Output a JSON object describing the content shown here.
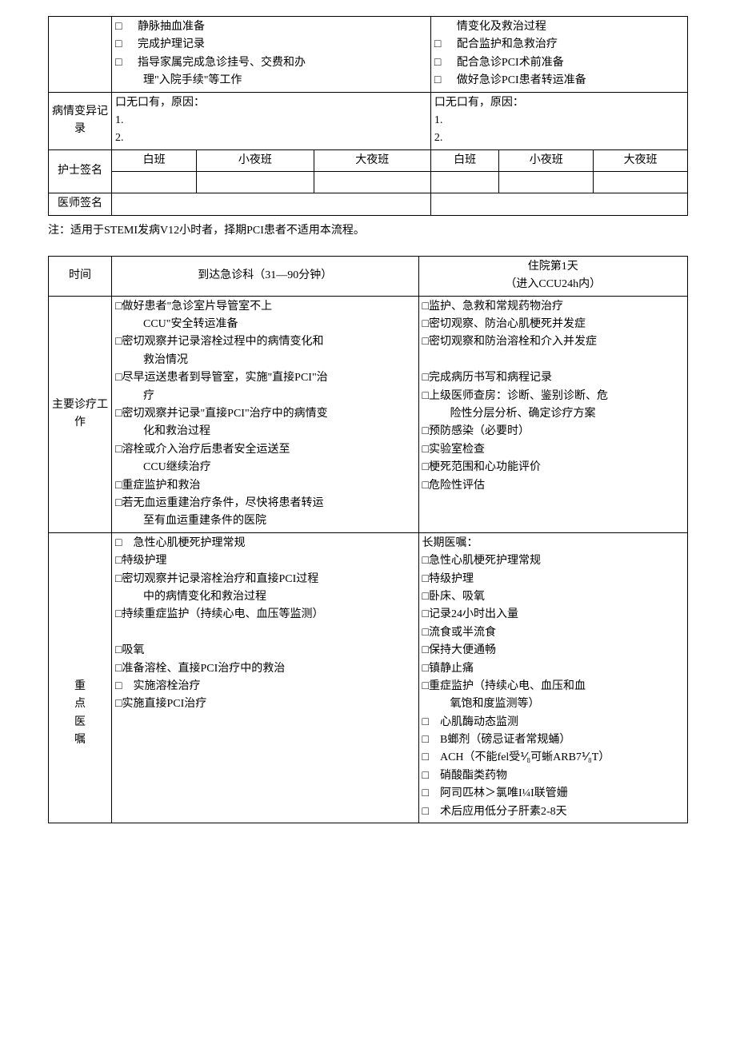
{
  "table1": {
    "row0": {
      "left": {
        "i1": "静脉抽血准备",
        "i2": "完成护理记录",
        "i3": "指导家属完成急诊挂号、交费和办",
        "i3b": "理\"入院手续\"等工作"
      },
      "right": {
        "i0": "情变化及救治过程",
        "i1": "配合监护和急救治疗",
        "i2": "配合急诊PCI术前准备",
        "i3": "做好急诊PCI患者转运准备"
      }
    },
    "row1": {
      "label": "病情变异记录",
      "left": {
        "head": "口无口有，原因：",
        "l1": "1.",
        "l2": "2."
      },
      "right": {
        "head": "口无口有，原因：",
        "l1": "1.",
        "l2": "2."
      }
    },
    "row2": {
      "label": "护士签名",
      "shifts": {
        "s1": "白班",
        "s2": "小夜班",
        "s3": "大夜班"
      }
    },
    "row3": {
      "label": "医师签名"
    }
  },
  "note": "注：适用于STEMI发病V12小时者，择期PCI患者不适用本流程。",
  "table2": {
    "header": {
      "c0": "时间",
      "c1": "到达急诊科（31—90分钟）",
      "c2a": "住院第1天",
      "c2b": "（进入CCU24h内）"
    },
    "mainwork": {
      "label": "主要诊疗工作",
      "left": {
        "i1": "做好患者\"急诊室片导管室不上",
        "i1b": "CCU\"安全转运准备",
        "i2": "密切观察并记录溶栓过程中的病情变化和",
        "i2b": "救治情况",
        "i3": "尽早运送患者到导管室，实施\"直接PCI\"治",
        "i3b": "疗",
        "i4": "密切观察并记录\"直接PCI\"治疗中的病情变",
        "i4b": "化和救治过程",
        "i5": "溶栓或介入治疗后患者安全运送至",
        "i5b": "CCU继续治疗",
        "i6": "重症监护和救治",
        "i7": "若无血运重建治疗条件，尽快将患者转运",
        "i7b": "至有血运重建条件的医院"
      },
      "right": {
        "i1": "监护、急救和常规药物治疗",
        "i2": "密切观察、防治心肌梗死并发症",
        "i3": "密切观察和防治溶栓和介入并发症",
        "i4": "完成病历书写和病程记录",
        "i5": "上级医师查房：诊断、鉴别诊断、危",
        "i5b": "险性分层分析、确定诊疗方案",
        "i6": "预防感染（必要时）",
        "i7": "实验室检查",
        "i8": "梗死范围和心功能评价",
        "i9": "危险性评估"
      }
    },
    "orders": {
      "label": {
        "a": "重",
        "b": "点",
        "c": "医",
        "d": "嘱"
      },
      "left": {
        "i1": "急性心肌梗死护理常规",
        "i2": "特级护理",
        "i3": "密切观察并记录溶栓治疗和直接PCI过程",
        "i3b": "中的病情变化和救治过程",
        "i4": "持续重症监护（持续心电、血压等监测）",
        "i5": "吸氧",
        "i6": "准备溶栓、直接PCI治疗中的救治",
        "i7": "实施溶栓治疗",
        "i8": "实施直接PCI治疗"
      },
      "right": {
        "head": "长期医嘱：",
        "i1": "急性心肌梗死护理常规",
        "i2": "特级护理",
        "i3": "卧床、吸氧",
        "i4": "记录24小时出入量",
        "i5": "流食或半流食",
        "i6": "保持大便通畅",
        "i7": "镇静止痛",
        "i8": "重症监护（持续心电、血压和血",
        "i8b": "氧饱和度监测等）",
        "i9": "心肌酶动态监测",
        "i10": "B螂剂（磅忌证者常规蛹）",
        "i11": "ACH（不能fel受⅟₈可蜥ARB7⅟₈T）",
        "i12": "硝酸酯类药物",
        "i13": "阿司匹林＞氯唯I¼I联管姗",
        "i14": "术后应用低分子肝素2-8天"
      }
    }
  },
  "box": "□"
}
